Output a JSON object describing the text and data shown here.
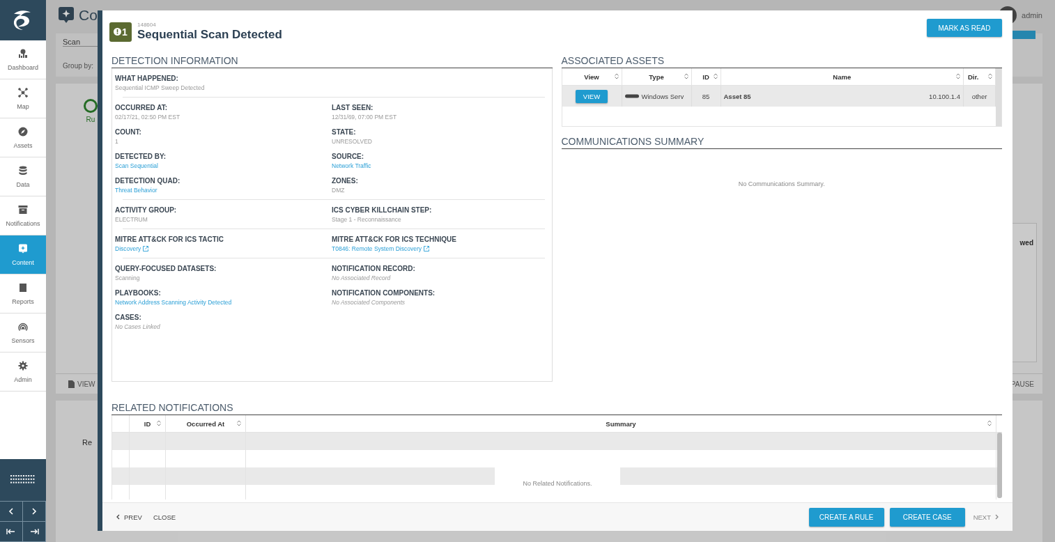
{
  "sidebar": {
    "items": [
      {
        "label": "Dashboard",
        "selected": false
      },
      {
        "label": "Map",
        "selected": false
      },
      {
        "label": "Assets",
        "selected": false
      },
      {
        "label": "Data",
        "selected": false
      },
      {
        "label": "Notifications",
        "selected": false
      },
      {
        "label": "Content",
        "selected": true
      },
      {
        "label": "Reports",
        "selected": false
      },
      {
        "label": "Sensors",
        "selected": false
      },
      {
        "label": "Admin",
        "selected": false
      }
    ]
  },
  "background": {
    "page_title": "Co",
    "user": "admin",
    "filter_value": "Scan",
    "group_by_label": "Group by:",
    "status_text": "Ru",
    "view_button": "VIEW",
    "pause_button": "PAUSE",
    "table_header": "wed",
    "card_text": "Re"
  },
  "modal": {
    "severity": "1",
    "id": "148604",
    "title": "Sequential Scan Detected",
    "mark_read_button": "MARK AS READ",
    "detection": {
      "heading": "DETECTION INFORMATION",
      "sections": [
        [
          {
            "label": "WHAT HAPPENED:",
            "value": "Sequential ICMP Sweep Detected",
            "kind": "plain"
          }
        ],
        [
          {
            "label": "OCCURRED AT:",
            "value": "02/17/21, 02:50 PM EST",
            "kind": "plain"
          },
          {
            "label": "LAST SEEN:",
            "value": "12/31/69, 07:00 PM EST",
            "kind": "plain"
          },
          {
            "label": "COUNT:",
            "value": "1",
            "kind": "plain"
          },
          {
            "label": "STATE:",
            "value": "UNRESOLVED",
            "kind": "plain"
          },
          {
            "label": "DETECTED BY:",
            "value": "Scan Sequential",
            "kind": "link"
          },
          {
            "label": "SOURCE:",
            "value": "Network Traffic",
            "kind": "link"
          },
          {
            "label": "DETECTION QUAD:",
            "value": "Threat Behavior",
            "kind": "link"
          },
          {
            "label": "ZONES:",
            "value": "DMZ",
            "kind": "plain"
          }
        ],
        [
          {
            "label": "ACTIVITY GROUP:",
            "value": "ELECTRUM",
            "kind": "plain"
          },
          {
            "label": "ICS CYBER KILLCHAIN STEP:",
            "value": "Stage 1 - Reconnaissance",
            "kind": "plain"
          }
        ],
        [
          {
            "label": "MITRE ATT&CK FOR ICS TACTIC",
            "value": "Discovery",
            "kind": "external"
          },
          {
            "label": "MITRE ATT&CK FOR ICS TECHNIQUE",
            "value": "T0846: Remote System Discovery",
            "kind": "external"
          }
        ],
        [
          {
            "label": "QUERY-FOCUSED DATASETS:",
            "value": "Scanning",
            "kind": "plain"
          },
          {
            "label": "NOTIFICATION RECORD:",
            "value": "No Associated Record",
            "kind": "none"
          },
          {
            "label": "PLAYBOOKS:",
            "value": "Network Address Scanning Activity Detected",
            "kind": "link"
          },
          {
            "label": "NOTIFICATION COMPONENTS:",
            "value": "No Associated Components",
            "kind": "none"
          },
          {
            "label": "CASES:",
            "value": "No Cases Linked",
            "kind": "none"
          }
        ]
      ]
    },
    "assets": {
      "heading": "ASSOCIATED ASSETS",
      "columns": [
        "View",
        "Type",
        "ID",
        "Name",
        "Dir."
      ],
      "rows": [
        {
          "view": "VIEW",
          "type": "Windows Serv",
          "id": "85",
          "name": "Asset 85",
          "ip": "10.100.1.4",
          "dir": "other"
        }
      ]
    },
    "communications": {
      "heading": "COMMUNICATIONS SUMMARY",
      "empty": "No Communications Summary."
    },
    "related": {
      "heading": "RELATED NOTIFICATIONS",
      "columns": [
        "",
        "ID",
        "Occurred At",
        "Summary"
      ],
      "empty": "No Related Notifications."
    },
    "footer": {
      "prev": "PREV",
      "close": "CLOSE",
      "create_rule": "CREATE A RULE",
      "create_case": "CREATE CASE",
      "next": "NEXT",
      "next_disabled": true
    }
  }
}
